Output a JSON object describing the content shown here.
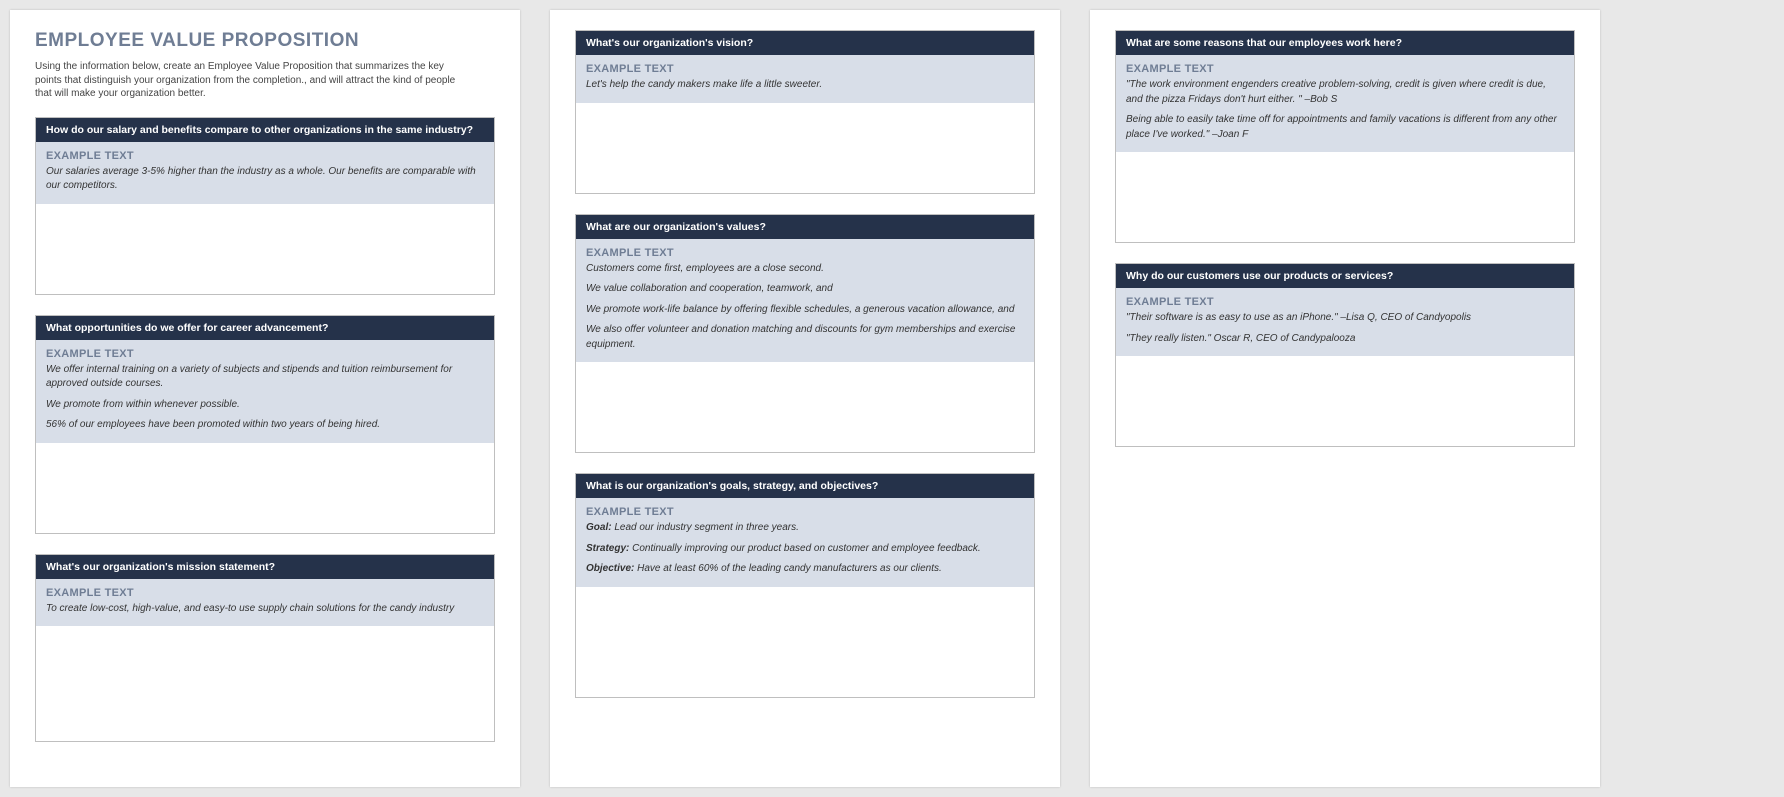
{
  "doc": {
    "title": "EMPLOYEE VALUE PROPOSITION",
    "intro": "Using the information below, create an Employee Value Proposition that summarizes the key points that distinguish your organization from the completion., and will attract the kind of people that will make your organization better."
  },
  "example_label": "EXAMPLE TEXT",
  "sections": {
    "salary": {
      "question": "How do our salary and benefits compare to other organizations in the same industry?",
      "lines": [
        "Our salaries average 3-5% higher than the industry as a whole. Our benefits are comparable with our competitors."
      ]
    },
    "career": {
      "question": "What opportunities do we offer for career advancement?",
      "lines": [
        "We offer internal training on a variety of subjects and stipends and tuition reimbursement for approved outside courses.",
        "We promote from within whenever possible.",
        "56% of our employees have been promoted within two years of being hired."
      ]
    },
    "mission": {
      "question": "What's our organization's mission statement?",
      "lines": [
        "To create low-cost, high-value, and easy-to use supply chain solutions for the candy industry"
      ]
    },
    "vision": {
      "question": "What's our organization's vision?",
      "lines": [
        "Let's help the candy makers make life a little sweeter."
      ]
    },
    "values": {
      "question": "What are our organization's values?",
      "lines": [
        "Customers come first, employees are a close second.",
        "We value collaboration and cooperation, teamwork, and",
        "We promote work-life balance by offering flexible schedules, a generous vacation allowance, and",
        "We also offer volunteer and donation matching and discounts for gym memberships and exercise equipment."
      ]
    },
    "goals": {
      "question": "What is our organization's goals, strategy, and objectives?",
      "goal_label": "Goal:",
      "goal_text": " Lead our industry segment in three years.",
      "strategy_label": "Strategy:",
      "strategy_text": " Continually improving our product based on customer and employee feedback.",
      "objective_label": "Objective:",
      "objective_text": " Have at least 60% of the leading candy manufacturers as our clients."
    },
    "reasons": {
      "question": "What are some reasons that our employees work here?",
      "lines": [
        "\"The work environment engenders creative problem-solving, credit is given where credit is due, and the pizza Fridays don't hurt either. \" –Bob S",
        "Being able to easily take time off for appointments and family vacations is different from any other place I've worked.\" –Joan F"
      ]
    },
    "customers": {
      "question": "Why do our customers use our products or services?",
      "lines": [
        "\"Their software is as easy to use as an iPhone.\" –Lisa Q, CEO of Candyopolis",
        "\"They really listen.\" Oscar R, CEO of Candypalooza"
      ]
    }
  }
}
